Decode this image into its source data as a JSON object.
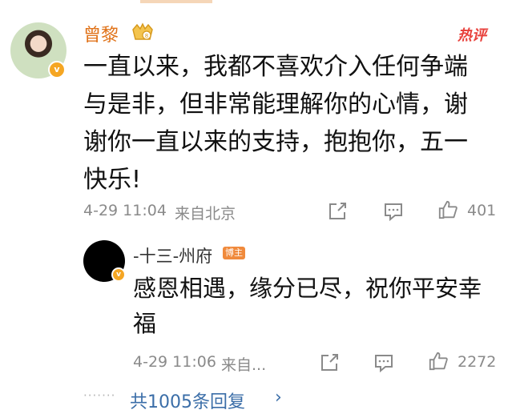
{
  "comment": {
    "author": "曾黎",
    "hot_tag": "热评",
    "text": "一直以来，我都不喜欢介入任何争端与是非，但非常能理解你的心情，谢谢你一直以来的支持，抱抱你，五一快乐!",
    "time": "4-29 11:04",
    "location": "来自北京",
    "likes": "401"
  },
  "reply": {
    "author": "-十三-州府",
    "author_badge": "博主",
    "text": "感恩相遇，缘分已尽，祝你平安幸福",
    "time": "4-29 11:06",
    "location": "来自...",
    "likes": "2272"
  },
  "thread": {
    "dots": "·······",
    "replies_label": "共1005条回复",
    "chevron": "›"
  },
  "icons": {
    "share": "share-icon",
    "comment": "comment-icon",
    "like": "thumbs-up-icon",
    "verified": "verified-badge-icon",
    "medal": "fan-medal-icon"
  },
  "colors": {
    "author_name": "#e0731a",
    "hot": "#e8413c",
    "link": "#3b6ea8",
    "meta": "#8a8a8a",
    "verified": "#f5a623"
  }
}
